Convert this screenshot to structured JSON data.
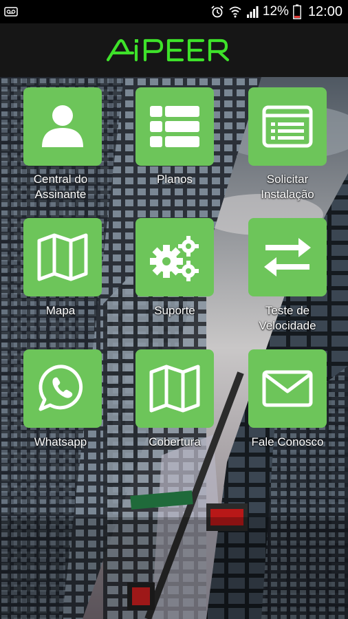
{
  "status_bar": {
    "left_icon": "voicemail-icon",
    "battery_percent": "12%",
    "time": "12:00",
    "icons": [
      "alarm-icon",
      "wifi-icon",
      "signal-icon",
      "battery-icon"
    ]
  },
  "app": {
    "logo_text": "AIPEER",
    "brand_color": "#3ee22a",
    "tile_color": "#6dc55a"
  },
  "menu": [
    {
      "label": "Central do\nAssinante",
      "icon": "user-icon"
    },
    {
      "label": "Planos",
      "icon": "list-icon"
    },
    {
      "label": "Solicitar\nInstalação",
      "icon": "form-icon"
    },
    {
      "label": "Mapa",
      "icon": "map-icon"
    },
    {
      "label": "Suporte",
      "icon": "gears-icon"
    },
    {
      "label": "Teste de\nVelocidade",
      "icon": "transfer-arrows-icon"
    },
    {
      "label": "Whatsapp",
      "icon": "whatsapp-icon"
    },
    {
      "label": "Cobertura",
      "icon": "map-icon"
    },
    {
      "label": "Fale Conosco",
      "icon": "envelope-icon"
    }
  ]
}
